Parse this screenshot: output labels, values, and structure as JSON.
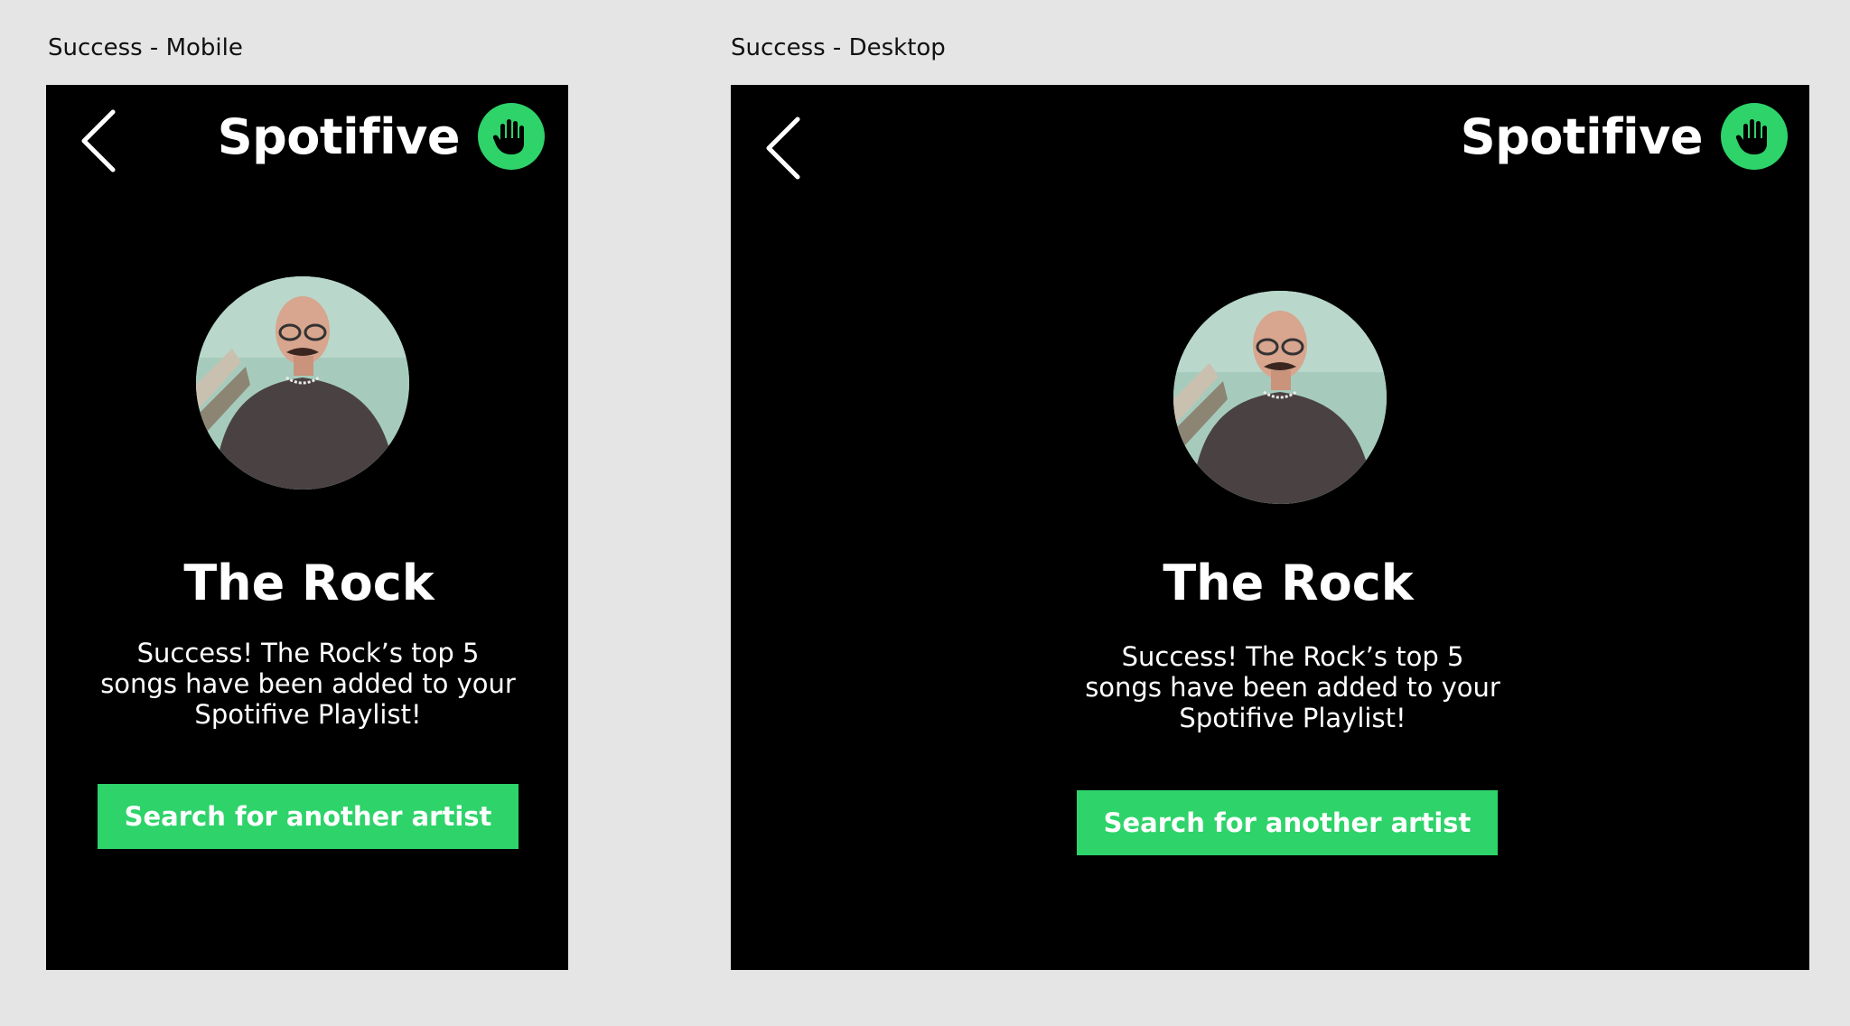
{
  "frames": {
    "mobile": {
      "label": "Success - Mobile",
      "brand": "Spotifive",
      "artist_name": "The Rock",
      "message_lines": [
        "Success! The Rock’s top 5",
        "songs have been added to your",
        "Spotifive Playlist!"
      ],
      "button_label": "Search for another artist"
    },
    "desktop": {
      "label": "Success - Desktop",
      "brand": "Spotifive",
      "artist_name": "The Rock",
      "message_lines": [
        "Success! The Rock’s top 5",
        "songs have been added to your",
        "Spotifive Playlist!"
      ],
      "button_label": "Search for another artist"
    }
  },
  "icons": {
    "back": "chevron-left-icon",
    "logo": "raised-hand-icon",
    "avatar": "artist-avatar"
  },
  "colors": {
    "accent": "#2ed36a",
    "frame_bg": "#000000",
    "canvas_bg": "#e5e5e5",
    "text": "#ffffff"
  }
}
